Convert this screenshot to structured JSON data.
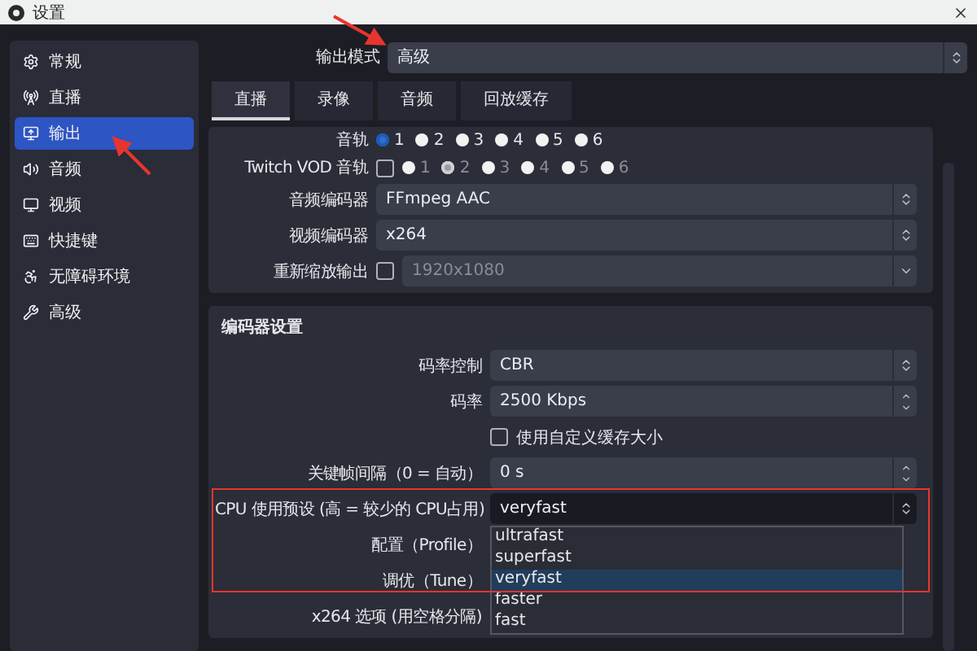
{
  "window": {
    "title": "设置"
  },
  "sidebar": {
    "items": [
      {
        "label": "常规",
        "selected": false
      },
      {
        "label": "直播",
        "selected": false
      },
      {
        "label": "输出",
        "selected": true
      },
      {
        "label": "音频",
        "selected": false
      },
      {
        "label": "视频",
        "selected": false
      },
      {
        "label": "快捷键",
        "selected": false
      },
      {
        "label": "无障碍环境",
        "selected": false
      },
      {
        "label": "高级",
        "selected": false
      }
    ]
  },
  "output_mode": {
    "label": "输出模式",
    "value": "高级"
  },
  "tabs": [
    {
      "label": "直播",
      "selected": true
    },
    {
      "label": "录像",
      "selected": false
    },
    {
      "label": "音频",
      "selected": false
    },
    {
      "label": "回放缓存",
      "selected": false
    }
  ],
  "stream_panel": {
    "rows": [
      {
        "kind": "radios",
        "label": "音轨",
        "disabled": false,
        "options": [
          {
            "label": "1",
            "selected": true
          },
          {
            "label": "2",
            "selected": false
          },
          {
            "label": "3",
            "selected": false
          },
          {
            "label": "4",
            "selected": false
          },
          {
            "label": "5",
            "selected": false
          },
          {
            "label": "6",
            "selected": false
          }
        ]
      },
      {
        "kind": "radios",
        "label": "Twitch VOD 音轨",
        "checked": false,
        "disabled": true,
        "options": [
          {
            "label": "1",
            "selected": false
          },
          {
            "label": "2",
            "selected": true
          },
          {
            "label": "3",
            "selected": false
          },
          {
            "label": "4",
            "selected": false
          },
          {
            "label": "5",
            "selected": false
          },
          {
            "label": "6",
            "selected": false
          }
        ]
      },
      {
        "kind": "select",
        "label": "音频编码器",
        "value": "FFmpeg AAC"
      },
      {
        "kind": "select",
        "label": "视频编码器",
        "value": "x264"
      },
      {
        "kind": "combo",
        "label": "重新缩放输出",
        "checked": false,
        "disabled": true,
        "value": "1920x1080"
      }
    ]
  },
  "encoder_panel": {
    "title": "编码器设置",
    "rows": [
      {
        "kind": "select",
        "label": "码率控制",
        "value": "CBR"
      },
      {
        "kind": "spin",
        "label": "码率",
        "value": "2500 Kbps"
      },
      {
        "kind": "checkbox",
        "label": "使用自定义缓存大小",
        "checked": false
      },
      {
        "kind": "spin",
        "label": "关键帧间隔（0 = 自动）",
        "value": "0 s"
      },
      {
        "kind": "select",
        "label": "CPU 使用预设 (高 = 较少的 CPU占用)",
        "value": "veryfast",
        "open": true,
        "options": [
          {
            "label": "ultrafast",
            "selected": false
          },
          {
            "label": "superfast",
            "selected": false
          },
          {
            "label": "veryfast",
            "selected": true
          },
          {
            "label": "faster",
            "selected": false
          },
          {
            "label": "fast",
            "selected": false
          }
        ]
      },
      {
        "kind": "label",
        "label": "配置（Profile）"
      },
      {
        "kind": "label",
        "label": "调优（Tune）"
      },
      {
        "kind": "label",
        "label": "x264 选项 (用空格分隔)"
      }
    ]
  }
}
